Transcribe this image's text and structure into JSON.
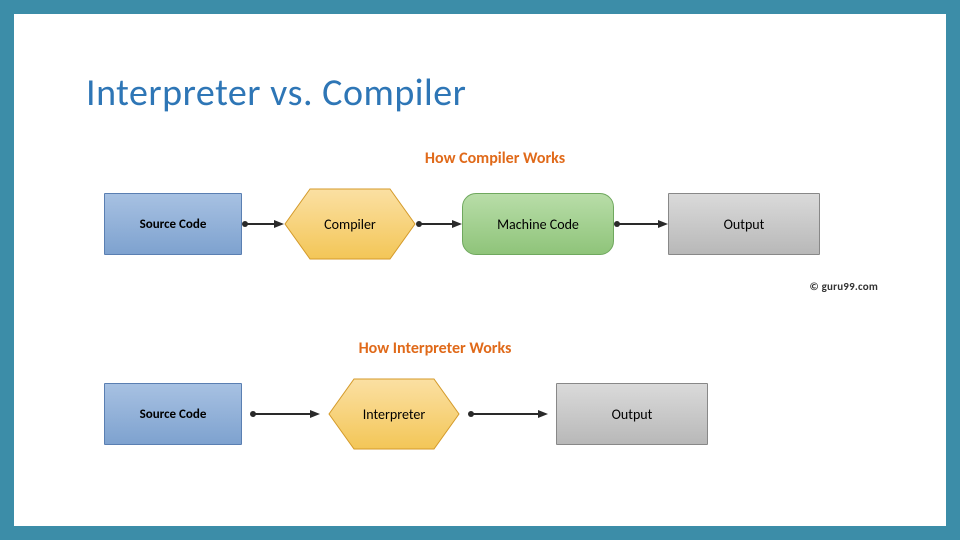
{
  "title": "Interpreter vs. Compiler",
  "compiler": {
    "heading": "How Compiler Works",
    "steps": {
      "source": "Source Code",
      "compiler": "Compiler",
      "machine": "Machine Code",
      "output": "Output"
    }
  },
  "interpreter": {
    "heading": "How Interpreter Works",
    "steps": {
      "source": "Source Code",
      "interpreter": "Interpreter",
      "output": "Output"
    }
  },
  "attribution": "© guru99.com"
}
